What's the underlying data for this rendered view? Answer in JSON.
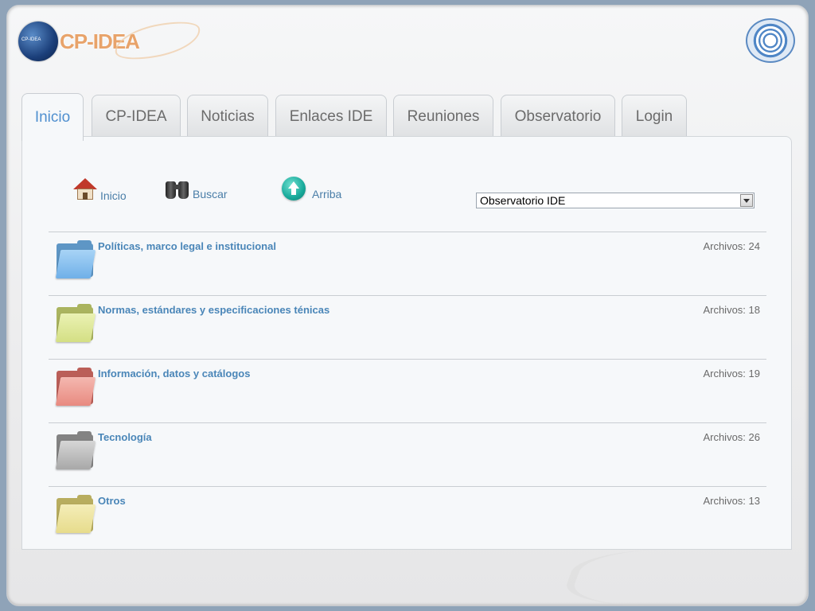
{
  "header": {
    "logo_text": "CP-IDEA",
    "logo_small_text": "CP-IDEA",
    "emblem_icon": "un-emblem-icon"
  },
  "tabs": [
    {
      "label": "Inicio",
      "active": true
    },
    {
      "label": "CP-IDEA",
      "active": false
    },
    {
      "label": "Noticias",
      "active": false
    },
    {
      "label": "Enlaces IDE",
      "active": false
    },
    {
      "label": "Reuniones",
      "active": false
    },
    {
      "label": "Observatorio",
      "active": false
    },
    {
      "label": "Login",
      "active": false
    }
  ],
  "toolbar": {
    "home_label": "Inicio",
    "search_label": "Buscar",
    "up_label": "Arriba",
    "select_value": "Observatorio IDE"
  },
  "folders": [
    {
      "title": "Políticas, marco legal e institucional",
      "count": "Archivos: 24",
      "color": "#6fb0e8"
    },
    {
      "title": "Normas, estándares y especificaciones ténicas",
      "count": "Archivos: 18",
      "color": "#d4df84"
    },
    {
      "title": "Información, datos y catálogos",
      "count": "Archivos: 19",
      "color": "#e88a80"
    },
    {
      "title": "Tecnología",
      "count": "Archivos: 26",
      "color": "#b4b4b4"
    },
    {
      "title": "Otros",
      "count": "Archivos: 13",
      "color": "#e7dc8c"
    }
  ],
  "colors": {
    "accent": "#4f8fcf",
    "link": "#4a86b8"
  }
}
